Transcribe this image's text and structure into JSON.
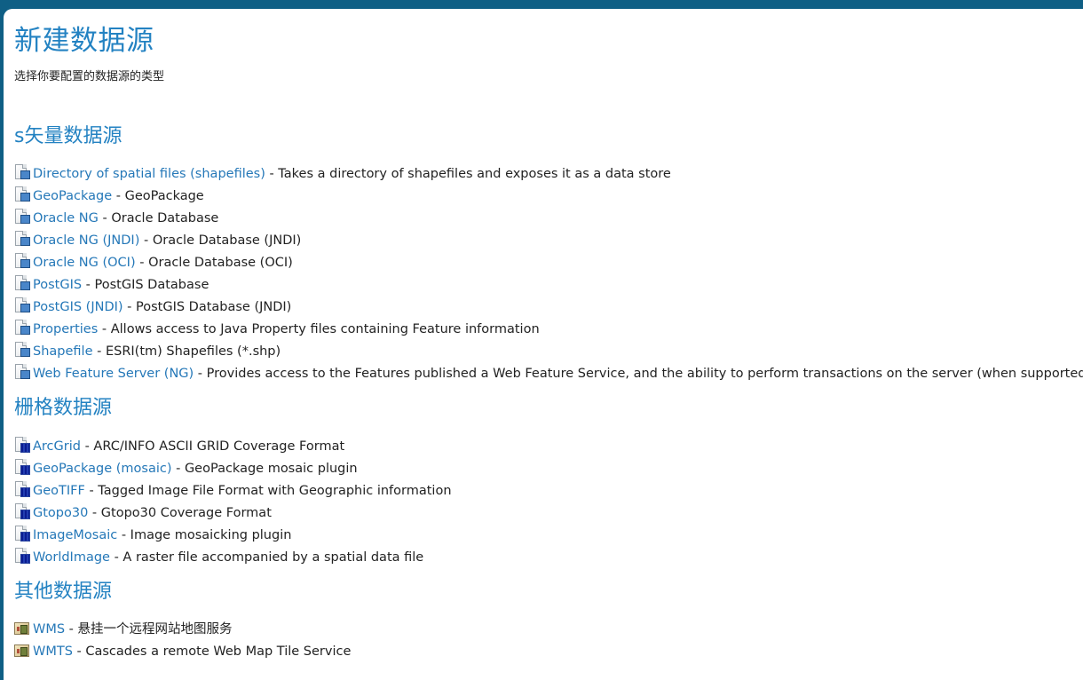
{
  "page": {
    "title": "新建数据源",
    "subtitle": "选择你要配置的数据源的类型"
  },
  "sections": {
    "vector": {
      "title": "s矢量数据源",
      "items": [
        {
          "name": "Directory of spatial files (shapefiles)",
          "desc": " - Takes a directory of shapefiles and exposes it as a data store",
          "icon": "vector-store-icon"
        },
        {
          "name": "GeoPackage",
          "desc": " - GeoPackage",
          "icon": "vector-store-icon"
        },
        {
          "name": "Oracle NG",
          "desc": " - Oracle Database",
          "icon": "vector-store-icon"
        },
        {
          "name": "Oracle NG (JNDI)",
          "desc": " - Oracle Database (JNDI)",
          "icon": "vector-store-icon"
        },
        {
          "name": "Oracle NG (OCI)",
          "desc": " - Oracle Database (OCI)",
          "icon": "vector-store-icon"
        },
        {
          "name": "PostGIS",
          "desc": " - PostGIS Database",
          "icon": "vector-store-icon"
        },
        {
          "name": "PostGIS (JNDI)",
          "desc": " - PostGIS Database (JNDI)",
          "icon": "vector-store-icon"
        },
        {
          "name": "Properties",
          "desc": " - Allows access to Java Property files containing Feature information",
          "icon": "vector-store-icon"
        },
        {
          "name": "Shapefile",
          "desc": " - ESRI(tm) Shapefiles (*.shp)",
          "icon": "vector-store-icon"
        },
        {
          "name": "Web Feature Server (NG)",
          "desc": " - Provides access to the Features published a Web Feature Service, and the ability to perform transactions on the server (when supported / allowed).",
          "icon": "wfs-store-icon"
        }
      ]
    },
    "raster": {
      "title": "栅格数据源",
      "items": [
        {
          "name": "ArcGrid",
          "desc": " - ARC/INFO ASCII GRID Coverage Format",
          "icon": "raster-store-icon"
        },
        {
          "name": "GeoPackage (mosaic)",
          "desc": " - GeoPackage mosaic plugin",
          "icon": "raster-store-icon"
        },
        {
          "name": "GeoTIFF",
          "desc": " - Tagged Image File Format with Geographic information",
          "icon": "raster-store-icon"
        },
        {
          "name": "Gtopo30",
          "desc": " - Gtopo30 Coverage Format",
          "icon": "raster-store-icon"
        },
        {
          "name": "ImageMosaic",
          "desc": " - Image mosaicking plugin",
          "icon": "raster-store-icon"
        },
        {
          "name": "WorldImage",
          "desc": " - A raster file accompanied by a spatial data file",
          "icon": "raster-store-icon"
        }
      ]
    },
    "other": {
      "title": "其他数据源",
      "items": [
        {
          "name": "WMS",
          "desc": " - 悬挂一个远程网站地图服务",
          "icon": "map-service-icon"
        },
        {
          "name": "WMTS",
          "desc": " - Cascades a remote Web Map Tile Service",
          "icon": "map-service-icon"
        }
      ]
    }
  },
  "colors": {
    "header_bar": "#0f5f85",
    "title": "#2382c2",
    "link": "#2578b8",
    "text": "#222222"
  }
}
